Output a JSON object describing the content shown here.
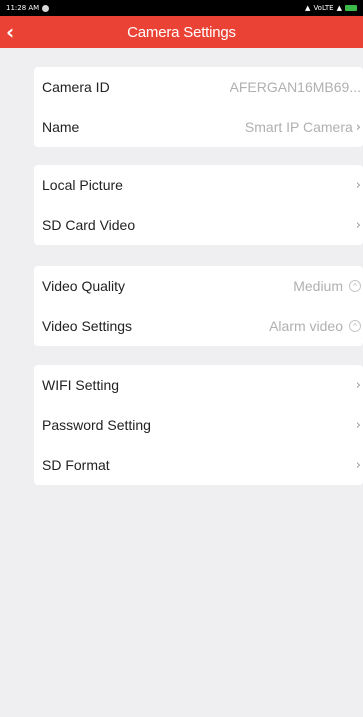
{
  "status_bar": {
    "time": "11:28 AM",
    "network": "VoLTE"
  },
  "header": {
    "back_icon": "chevron-left-icon",
    "title": "Camera Settings"
  },
  "groups": [
    {
      "items": [
        {
          "label": "Camera ID",
          "value": "AFERGAN16MB69..."
        },
        {
          "label": "Name",
          "value": "Smart IP Camera"
        }
      ]
    },
    {
      "items": [
        {
          "label": "Local Picture",
          "value": ""
        },
        {
          "label": "SD Card Video",
          "value": ""
        }
      ]
    },
    {
      "items": [
        {
          "label": "Video Quality",
          "value": "Medium"
        },
        {
          "label": "Video Settings",
          "value": "Alarm video"
        }
      ]
    },
    {
      "items": [
        {
          "label": "WIFI Setting",
          "value": ""
        },
        {
          "label": "Password Setting",
          "value": ""
        },
        {
          "label": "SD Format",
          "value": ""
        }
      ]
    }
  ],
  "colors": {
    "header_bg": "#ea4335",
    "page_bg": "#efeff1",
    "value_text": "#b0b0b0"
  }
}
